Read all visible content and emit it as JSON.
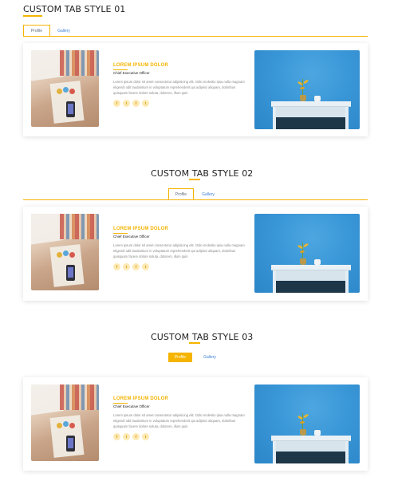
{
  "sections": [
    {
      "title": "CUSTOM TAB STYLE 01",
      "tabs": [
        {
          "label": "Profile",
          "active": true
        },
        {
          "label": "Gallery",
          "active": false
        }
      ]
    },
    {
      "title": "CUSTOM TAB STYLE 02",
      "tabs": [
        {
          "label": "Profile",
          "active": true
        },
        {
          "label": "Gallery",
          "active": false
        }
      ]
    },
    {
      "title": "CUSTOM TAB STYLE 03",
      "tabs": [
        {
          "label": "Profile",
          "active": true
        },
        {
          "label": "Gallery",
          "active": false
        }
      ]
    }
  ],
  "profile": {
    "name": "LOREM IPSUM DOLOR",
    "role": "Chief Executive Officer",
    "description": "Lorem ipsum dolor sit amet consectetur adipisicing elit. Odio molestio ipsa nulla magnam eligendi odit laudantium in voluptatum reprehenderit qui adipisci aliquam, doloribus quisquam facere dolore soluta, dolorem, illum quis",
    "social": [
      {
        "icon": "facebook-icon",
        "glyph": "f"
      },
      {
        "icon": "twitter-icon",
        "glyph": "t"
      },
      {
        "icon": "facebook-icon",
        "glyph": "f"
      },
      {
        "icon": "twitter-icon",
        "glyph": "t"
      }
    ]
  },
  "colors": {
    "accent": "#f5b400",
    "tab_link": "#3c7fd8",
    "photo_blue": "#3a97d7"
  }
}
